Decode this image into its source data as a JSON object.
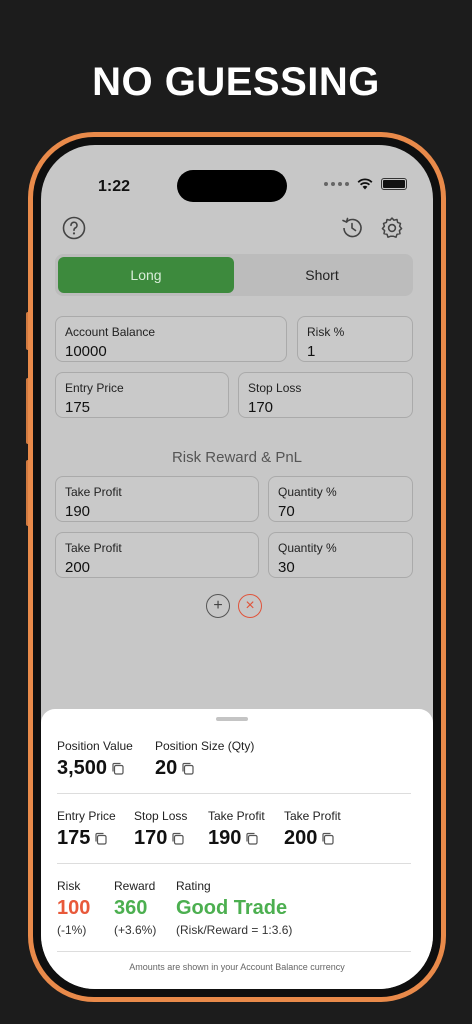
{
  "headline": "NO GUESSING",
  "status_bar": {
    "time": "1:22"
  },
  "toolbar": {
    "help_icon": "question-circle-icon",
    "history_icon": "history-icon",
    "settings_icon": "gear-icon"
  },
  "direction": {
    "long_label": "Long",
    "short_label": "Short",
    "selected": "Long"
  },
  "inputs": {
    "account_balance": {
      "label": "Account Balance",
      "value": "10000"
    },
    "risk_percent": {
      "label": "Risk %",
      "value": "1"
    },
    "entry_price": {
      "label": "Entry Price",
      "value": "175"
    },
    "stop_loss": {
      "label": "Stop Loss",
      "value": "170"
    }
  },
  "targets_section_title": "Risk Reward & PnL",
  "targets": [
    {
      "tp_label": "Take Profit",
      "tp_value": "190",
      "qty_label": "Quantity %",
      "qty_value": "70"
    },
    {
      "tp_label": "Take Profit",
      "tp_value": "200",
      "qty_label": "Quantity %",
      "qty_value": "30"
    }
  ],
  "target_actions": {
    "add_symbol": "+",
    "remove_symbol": "×"
  },
  "results": {
    "position_value": {
      "label": "Position Value",
      "value": "3,500"
    },
    "position_size": {
      "label": "Position Size (Qty)",
      "value": "20"
    },
    "entry_price": {
      "label": "Entry Price",
      "value": "175"
    },
    "stop_loss": {
      "label": "Stop Loss",
      "value": "170"
    },
    "take_profit_1": {
      "label": "Take Profit",
      "value": "190"
    },
    "take_profit_2": {
      "label": "Take Profit",
      "value": "200"
    },
    "risk": {
      "label": "Risk",
      "value": "100",
      "sub": "(-1%)"
    },
    "reward": {
      "label": "Reward",
      "value": "360",
      "sub": "(+3.6%)"
    },
    "rating": {
      "label": "Rating",
      "value": "Good Trade",
      "sub": "(Risk/Reward = 1:3.6)"
    },
    "footnote": "Amounts are shown in your Account Balance currency"
  },
  "colors": {
    "long_active": "#3d8a3d",
    "risk": "#e8593a",
    "reward": "#4caf50",
    "rating": "#4caf50",
    "phone_frame": "#e98a4a"
  }
}
